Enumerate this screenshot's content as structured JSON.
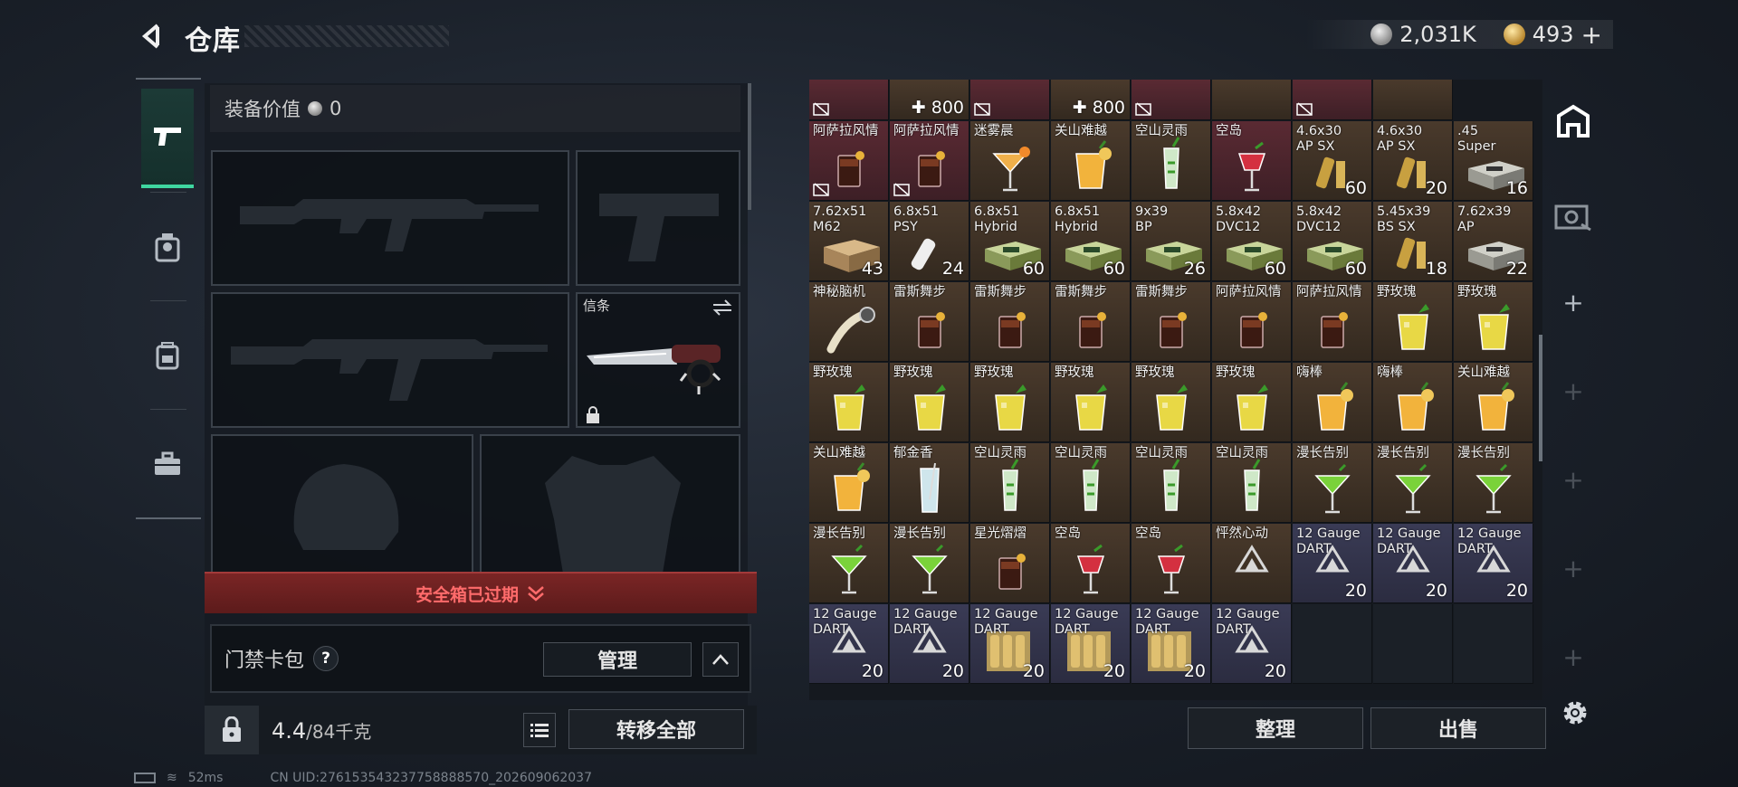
{
  "header": {
    "title": "仓库",
    "silver": "2,031K",
    "gold": "493",
    "gold_plus": "+"
  },
  "left_nav": {
    "items": [
      "weapon-icon",
      "character-icon",
      "backpack-icon",
      "briefcase-icon"
    ]
  },
  "equipment": {
    "value_label": "装备价值",
    "value": "0",
    "melee_label": "信条"
  },
  "safe_box": {
    "text": "安全箱已过期"
  },
  "card_pack": {
    "label": "门禁卡包",
    "help": "?",
    "manage": "管理"
  },
  "bottom": {
    "weight": "4.4",
    "weight_max": "/84千克",
    "transfer": "转移全部"
  },
  "storage": {
    "top_row": [
      {
        "mark": true
      },
      {
        "text": "✚ 800"
      },
      {
        "mark": true
      },
      {
        "text": "✚ 800"
      },
      {
        "mark": true
      },
      {},
      {
        "mark": true
      },
      {}
    ],
    "rows": [
      [
        {
          "name": "阿萨拉风情",
          "color": "red",
          "icon": "cola",
          "mark": true
        },
        {
          "name": "阿萨拉风情",
          "color": "red",
          "icon": "cola",
          "mark": true
        },
        {
          "name": "迷雾晨",
          "color": "brown",
          "icon": "martini-orange"
        },
        {
          "name": "关山难越",
          "color": "brown",
          "icon": "juice"
        },
        {
          "name": "空山灵雨",
          "color": "brown",
          "icon": "mojito"
        },
        {
          "name": "空岛",
          "color": "red",
          "icon": "red-cocktail"
        },
        {
          "name": "4.6x30\nAP SX",
          "color": "brown",
          "icon": "ammo-single",
          "count": "60"
        },
        {
          "name": "4.6x30\nAP SX",
          "color": "brown",
          "icon": "ammo-single",
          "count": "20"
        },
        {
          "name": ".45\nSuper",
          "color": "brown",
          "icon": "ammo-box-gray",
          "count": "16"
        }
      ],
      [
        {
          "name": "7.62x51\nM62",
          "color": "brown",
          "icon": "ammo-box-tan",
          "count": "43"
        },
        {
          "name": "6.8x51\nPSY",
          "color": "brown",
          "icon": "ammo-single-white",
          "count": "24"
        },
        {
          "name": "6.8x51\nHybrid",
          "color": "brown",
          "icon": "ammo-box-green",
          "count": "60"
        },
        {
          "name": "6.8x51\nHybrid",
          "color": "brown",
          "icon": "ammo-box-green",
          "count": "60"
        },
        {
          "name": "9x39\nBP",
          "color": "brown",
          "icon": "ammo-box-green",
          "count": "26"
        },
        {
          "name": "5.8x42\nDVC12",
          "color": "brown",
          "icon": "ammo-box-green",
          "count": "60"
        },
        {
          "name": "5.8x42\nDVC12",
          "color": "brown",
          "icon": "ammo-box-green",
          "count": "60"
        },
        {
          "name": "5.45x39\nBS SX",
          "color": "brown",
          "icon": "ammo-single",
          "count": "18"
        },
        {
          "name": "7.62x39\nAP",
          "color": "brown",
          "icon": "ammo-box-gray",
          "count": "22"
        }
      ],
      [
        {
          "name": "神秘脑机",
          "color": "brown",
          "icon": "device"
        },
        {
          "name": "雷斯舞步",
          "color": "brown",
          "icon": "cola"
        },
        {
          "name": "雷斯舞步",
          "color": "brown",
          "icon": "cola"
        },
        {
          "name": "雷斯舞步",
          "color": "brown",
          "icon": "cola"
        },
        {
          "name": "雷斯舞步",
          "color": "brown",
          "icon": "cola"
        },
        {
          "name": "阿萨拉风情",
          "color": "brown",
          "icon": "cola"
        },
        {
          "name": "阿萨拉风情",
          "color": "brown",
          "icon": "cola"
        },
        {
          "name": "野玫瑰",
          "color": "brown",
          "icon": "lemonade"
        },
        {
          "name": "野玫瑰",
          "color": "brown",
          "icon": "lemonade"
        }
      ],
      [
        {
          "name": "野玫瑰",
          "color": "brown",
          "icon": "lemonade"
        },
        {
          "name": "野玫瑰",
          "color": "brown",
          "icon": "lemonade"
        },
        {
          "name": "野玫瑰",
          "color": "brown",
          "icon": "lemonade"
        },
        {
          "name": "野玫瑰",
          "color": "brown",
          "icon": "lemonade"
        },
        {
          "name": "野玫瑰",
          "color": "brown",
          "icon": "lemonade"
        },
        {
          "name": "野玫瑰",
          "color": "brown",
          "icon": "lemonade"
        },
        {
          "name": "嗨棒",
          "color": "brown",
          "icon": "juice"
        },
        {
          "name": "嗨棒",
          "color": "brown",
          "icon": "juice"
        },
        {
          "name": "关山难越",
          "color": "brown",
          "icon": "juice"
        }
      ],
      [
        {
          "name": "关山难越",
          "color": "brown",
          "icon": "juice"
        },
        {
          "name": "郁金香",
          "color": "brown",
          "icon": "tall-glass"
        },
        {
          "name": "空山灵雨",
          "color": "brown",
          "icon": "mojito"
        },
        {
          "name": "空山灵雨",
          "color": "brown",
          "icon": "mojito"
        },
        {
          "name": "空山灵雨",
          "color": "brown",
          "icon": "mojito"
        },
        {
          "name": "空山灵雨",
          "color": "brown",
          "icon": "mojito"
        },
        {
          "name": "漫长告别",
          "color": "brown",
          "icon": "martini-green"
        },
        {
          "name": "漫长告别",
          "color": "brown",
          "icon": "martini-green"
        },
        {
          "name": "漫长告别",
          "color": "brown",
          "icon": "martini-green"
        }
      ],
      [
        {
          "name": "漫长告别",
          "color": "brown",
          "icon": "martini-green"
        },
        {
          "name": "漫长告别",
          "color": "brown",
          "icon": "martini-green"
        },
        {
          "name": "星光熠熠",
          "color": "brown",
          "icon": "cola"
        },
        {
          "name": "空岛",
          "color": "brown",
          "icon": "red-cocktail"
        },
        {
          "name": "空岛",
          "color": "brown",
          "icon": "red-cocktail"
        },
        {
          "name": "怦然心动",
          "color": "brown",
          "icon": "triangle"
        },
        {
          "name": "12 Gauge\nDART",
          "color": "purple",
          "icon": "triangle",
          "count": "20"
        },
        {
          "name": "12 Gauge\nDART",
          "color": "purple",
          "icon": "triangle",
          "count": "20"
        },
        {
          "name": "12 Gauge\nDART",
          "color": "purple",
          "icon": "triangle",
          "count": "20"
        }
      ],
      [
        {
          "name": "12 Gauge\nDART",
          "color": "purple",
          "icon": "triangle",
          "count": "20"
        },
        {
          "name": "12 Gauge\nDART",
          "color": "purple",
          "icon": "triangle",
          "count": "20"
        },
        {
          "name": "12 Gauge\nDART",
          "color": "purple",
          "icon": "shell-box",
          "count": "20"
        },
        {
          "name": "12 Gauge\nDART",
          "color": "purple",
          "icon": "shell-box",
          "count": "20"
        },
        {
          "name": "12 Gauge\nDART",
          "color": "purple",
          "icon": "shell-box",
          "count": "20"
        },
        {
          "name": "12 Gauge\nDART",
          "color": "purple",
          "icon": "triangle",
          "count": "20"
        },
        {
          "color": "empty"
        },
        {
          "color": "empty"
        },
        {
          "color": "empty"
        }
      ]
    ]
  },
  "actions": {
    "sort": "整理",
    "sell": "出售"
  },
  "status": {
    "ping": "52ms",
    "uid": "CN UID:276153543237758888570_202609062037"
  },
  "colors": {
    "accent": "#3fd6a0",
    "alert": "#ff6b6b"
  }
}
